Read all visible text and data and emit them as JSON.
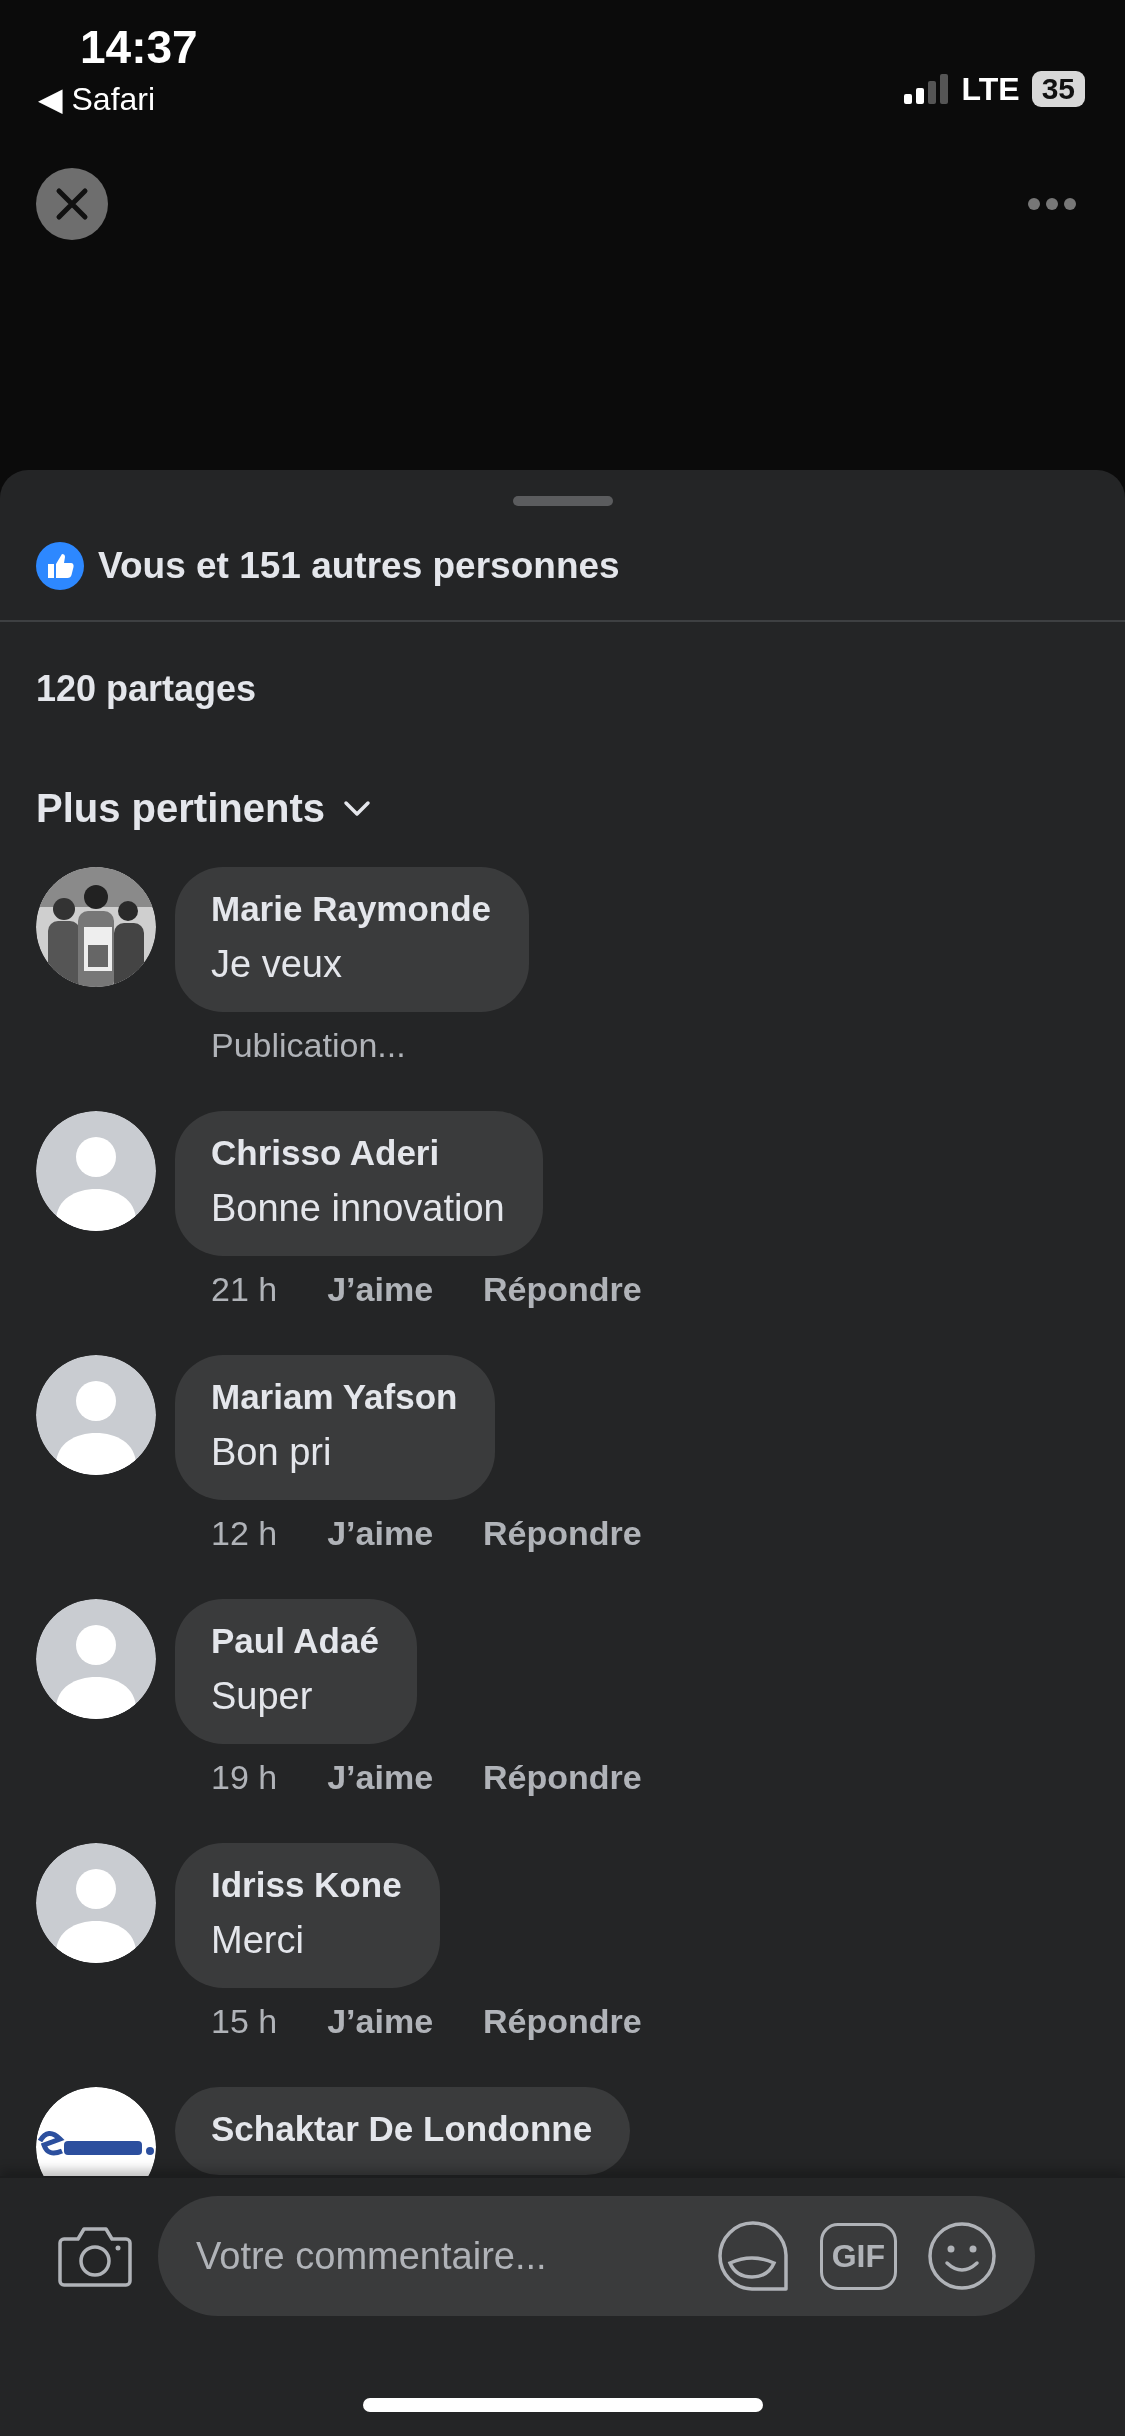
{
  "status_bar": {
    "time": "14:37",
    "back_label": "◀ Safari",
    "network": "LTE",
    "battery": "35"
  },
  "reactions": {
    "summary": "Vous et 151 autres personnes"
  },
  "shares": "120 partages",
  "sort": {
    "label": "Plus pertinents"
  },
  "comments": [
    {
      "kind": "pending",
      "name": "Marie Raymonde",
      "text": "Je veux",
      "status": "Publication..."
    },
    {
      "kind": "posted",
      "avatar": {
        "kind": "default"
      },
      "name": "Chrisso Aderi",
      "text": "Bonne innovation",
      "time": "21 h",
      "like": "J’aime",
      "reply": "Répondre"
    },
    {
      "kind": "posted",
      "avatar": {
        "kind": "default"
      },
      "name": "Mariam Yafson",
      "text": "Bon pri",
      "time": "12 h",
      "like": "J’aime",
      "reply": "Répondre"
    },
    {
      "kind": "posted",
      "avatar": {
        "kind": "default"
      },
      "name": "Paul Adaé",
      "text": "Super",
      "time": "19 h",
      "like": "J’aime",
      "reply": "Répondre"
    },
    {
      "kind": "posted",
      "avatar": {
        "kind": "default"
      },
      "name": "Idriss Kone",
      "text": "Merci",
      "time": "15 h",
      "like": "J’aime",
      "reply": "Répondre"
    },
    {
      "kind": "cut",
      "avatar": {
        "kind": "logo"
      },
      "name": "Schaktar De Londonne"
    }
  ],
  "composer": {
    "placeholder": "Votre commentaire...",
    "gif_label": "GIF"
  }
}
